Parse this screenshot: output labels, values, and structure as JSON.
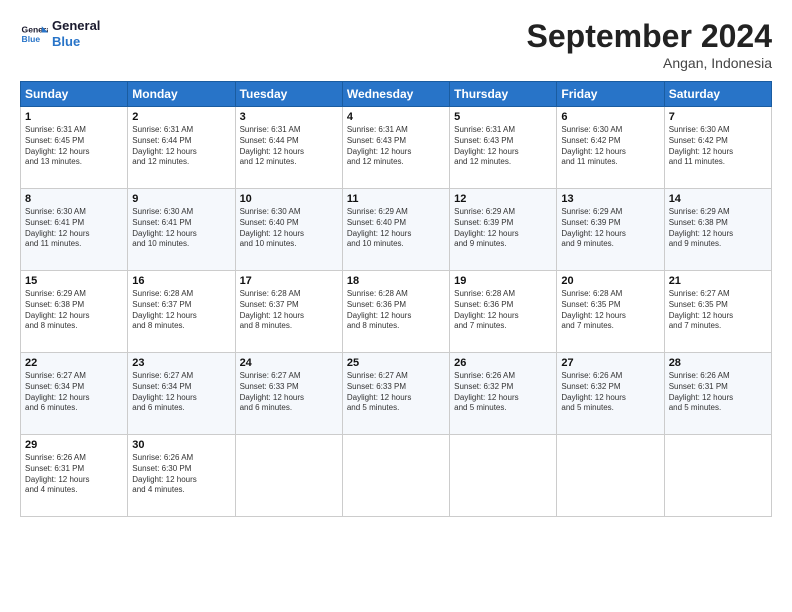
{
  "header": {
    "logo_line1": "General",
    "logo_line2": "Blue",
    "month": "September 2024",
    "location": "Angan, Indonesia"
  },
  "days_of_week": [
    "Sunday",
    "Monday",
    "Tuesday",
    "Wednesday",
    "Thursday",
    "Friday",
    "Saturday"
  ],
  "weeks": [
    [
      {
        "day": "1",
        "info": "Sunrise: 6:31 AM\nSunset: 6:45 PM\nDaylight: 12 hours\nand 13 minutes."
      },
      {
        "day": "2",
        "info": "Sunrise: 6:31 AM\nSunset: 6:44 PM\nDaylight: 12 hours\nand 12 minutes."
      },
      {
        "day": "3",
        "info": "Sunrise: 6:31 AM\nSunset: 6:44 PM\nDaylight: 12 hours\nand 12 minutes."
      },
      {
        "day": "4",
        "info": "Sunrise: 6:31 AM\nSunset: 6:43 PM\nDaylight: 12 hours\nand 12 minutes."
      },
      {
        "day": "5",
        "info": "Sunrise: 6:31 AM\nSunset: 6:43 PM\nDaylight: 12 hours\nand 12 minutes."
      },
      {
        "day": "6",
        "info": "Sunrise: 6:30 AM\nSunset: 6:42 PM\nDaylight: 12 hours\nand 11 minutes."
      },
      {
        "day": "7",
        "info": "Sunrise: 6:30 AM\nSunset: 6:42 PM\nDaylight: 12 hours\nand 11 minutes."
      }
    ],
    [
      {
        "day": "8",
        "info": "Sunrise: 6:30 AM\nSunset: 6:41 PM\nDaylight: 12 hours\nand 11 minutes."
      },
      {
        "day": "9",
        "info": "Sunrise: 6:30 AM\nSunset: 6:41 PM\nDaylight: 12 hours\nand 10 minutes."
      },
      {
        "day": "10",
        "info": "Sunrise: 6:30 AM\nSunset: 6:40 PM\nDaylight: 12 hours\nand 10 minutes."
      },
      {
        "day": "11",
        "info": "Sunrise: 6:29 AM\nSunset: 6:40 PM\nDaylight: 12 hours\nand 10 minutes."
      },
      {
        "day": "12",
        "info": "Sunrise: 6:29 AM\nSunset: 6:39 PM\nDaylight: 12 hours\nand 9 minutes."
      },
      {
        "day": "13",
        "info": "Sunrise: 6:29 AM\nSunset: 6:39 PM\nDaylight: 12 hours\nand 9 minutes."
      },
      {
        "day": "14",
        "info": "Sunrise: 6:29 AM\nSunset: 6:38 PM\nDaylight: 12 hours\nand 9 minutes."
      }
    ],
    [
      {
        "day": "15",
        "info": "Sunrise: 6:29 AM\nSunset: 6:38 PM\nDaylight: 12 hours\nand 8 minutes."
      },
      {
        "day": "16",
        "info": "Sunrise: 6:28 AM\nSunset: 6:37 PM\nDaylight: 12 hours\nand 8 minutes."
      },
      {
        "day": "17",
        "info": "Sunrise: 6:28 AM\nSunset: 6:37 PM\nDaylight: 12 hours\nand 8 minutes."
      },
      {
        "day": "18",
        "info": "Sunrise: 6:28 AM\nSunset: 6:36 PM\nDaylight: 12 hours\nand 8 minutes."
      },
      {
        "day": "19",
        "info": "Sunrise: 6:28 AM\nSunset: 6:36 PM\nDaylight: 12 hours\nand 7 minutes."
      },
      {
        "day": "20",
        "info": "Sunrise: 6:28 AM\nSunset: 6:35 PM\nDaylight: 12 hours\nand 7 minutes."
      },
      {
        "day": "21",
        "info": "Sunrise: 6:27 AM\nSunset: 6:35 PM\nDaylight: 12 hours\nand 7 minutes."
      }
    ],
    [
      {
        "day": "22",
        "info": "Sunrise: 6:27 AM\nSunset: 6:34 PM\nDaylight: 12 hours\nand 6 minutes."
      },
      {
        "day": "23",
        "info": "Sunrise: 6:27 AM\nSunset: 6:34 PM\nDaylight: 12 hours\nand 6 minutes."
      },
      {
        "day": "24",
        "info": "Sunrise: 6:27 AM\nSunset: 6:33 PM\nDaylight: 12 hours\nand 6 minutes."
      },
      {
        "day": "25",
        "info": "Sunrise: 6:27 AM\nSunset: 6:33 PM\nDaylight: 12 hours\nand 5 minutes."
      },
      {
        "day": "26",
        "info": "Sunrise: 6:26 AM\nSunset: 6:32 PM\nDaylight: 12 hours\nand 5 minutes."
      },
      {
        "day": "27",
        "info": "Sunrise: 6:26 AM\nSunset: 6:32 PM\nDaylight: 12 hours\nand 5 minutes."
      },
      {
        "day": "28",
        "info": "Sunrise: 6:26 AM\nSunset: 6:31 PM\nDaylight: 12 hours\nand 5 minutes."
      }
    ],
    [
      {
        "day": "29",
        "info": "Sunrise: 6:26 AM\nSunset: 6:31 PM\nDaylight: 12 hours\nand 4 minutes."
      },
      {
        "day": "30",
        "info": "Sunrise: 6:26 AM\nSunset: 6:30 PM\nDaylight: 12 hours\nand 4 minutes."
      },
      {
        "day": "",
        "info": ""
      },
      {
        "day": "",
        "info": ""
      },
      {
        "day": "",
        "info": ""
      },
      {
        "day": "",
        "info": ""
      },
      {
        "day": "",
        "info": ""
      }
    ]
  ]
}
